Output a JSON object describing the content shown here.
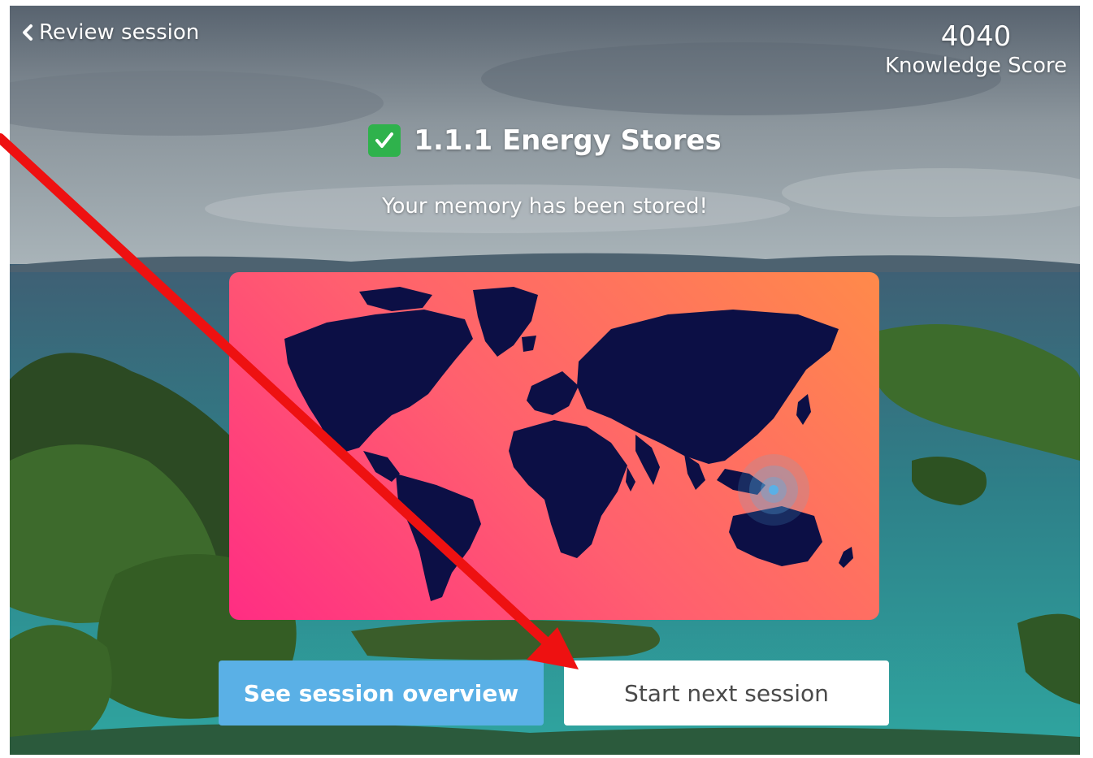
{
  "nav": {
    "back_label": "Review session",
    "back_icon": "chevron-left-icon"
  },
  "score": {
    "value": "4040",
    "label": "Knowledge Score"
  },
  "topic": {
    "title": "1.1.1 Energy Stores",
    "status_icon": "check-box-icon",
    "status_color": "#2fb24c"
  },
  "message": "Your memory has been stored!",
  "map": {
    "type": "world-map",
    "gradient": [
      "#ff2d83",
      "#ff8a4a"
    ],
    "land_color": "#0c0f45",
    "marker_color": "#5ab0e6"
  },
  "buttons": {
    "overview": "See session overview",
    "next": "Start next session"
  },
  "annotation": {
    "type": "arrow",
    "color": "#ee1111"
  },
  "colors": {
    "primary_button": "#5ab0e6",
    "secondary_button": "#ffffff"
  }
}
